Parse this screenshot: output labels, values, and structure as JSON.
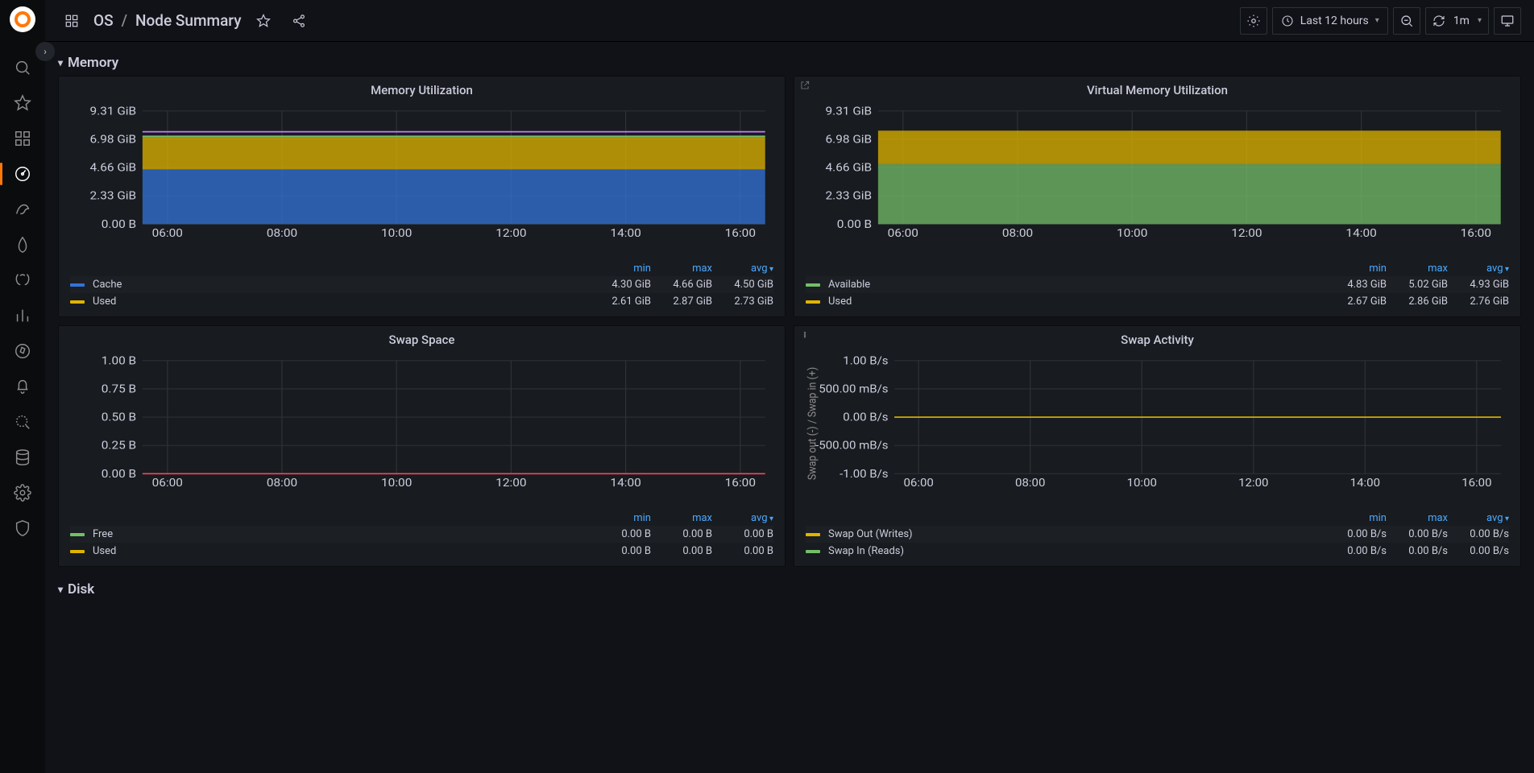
{
  "breadcrumb": {
    "folder": "OS",
    "page": "Node Summary"
  },
  "toolbar": {
    "time_range": "Last 12 hours",
    "refresh_interval": "1m"
  },
  "sections": {
    "memory": "Memory",
    "disk": "Disk"
  },
  "legend_cols": {
    "min": "min",
    "max": "max",
    "avg": "avg"
  },
  "chart_data": [
    {
      "id": "mem_util",
      "type": "area",
      "title": "Memory Utilization",
      "ylabel": "",
      "y_ticks": [
        "0.00 B",
        "2.33 GiB",
        "4.66 GiB",
        "6.98 GiB",
        "9.31 GiB"
      ],
      "ylim_gib": [
        0,
        9.31
      ],
      "x_ticks": [
        "06:00",
        "08:00",
        "10:00",
        "12:00",
        "14:00",
        "16:00"
      ],
      "series": [
        {
          "name": "Cache",
          "color": "#3274d9",
          "band": [
            0,
            4.5
          ],
          "stats": {
            "min": "4.30 GiB",
            "max": "4.66 GiB",
            "avg": "4.50 GiB"
          }
        },
        {
          "name": "Used",
          "color": "#e0b400",
          "band": [
            4.5,
            7.23
          ],
          "stats": {
            "min": "2.61 GiB",
            "max": "2.87 GiB",
            "avg": "2.73 GiB"
          }
        }
      ],
      "overlay_line": {
        "color": "#c77dff",
        "y_gib": 7.6
      },
      "top_line": {
        "color": "#73bf69",
        "y_gib": 7.23
      }
    },
    {
      "id": "vmem_util",
      "type": "area",
      "title": "Virtual Memory Utilization",
      "ylabel": "",
      "y_ticks": [
        "0.00 B",
        "2.33 GiB",
        "4.66 GiB",
        "6.98 GiB",
        "9.31 GiB"
      ],
      "ylim_gib": [
        0,
        9.31
      ],
      "x_ticks": [
        "06:00",
        "08:00",
        "10:00",
        "12:00",
        "14:00",
        "16:00"
      ],
      "corner_icon": "popout",
      "series": [
        {
          "name": "Available",
          "color": "#73bf69",
          "band": [
            0,
            4.93
          ],
          "stats": {
            "min": "4.83 GiB",
            "max": "5.02 GiB",
            "avg": "4.93 GiB"
          }
        },
        {
          "name": "Used",
          "color": "#e0b400",
          "band": [
            4.93,
            7.69
          ],
          "stats": {
            "min": "2.67 GiB",
            "max": "2.86 GiB",
            "avg": "2.76 GiB"
          }
        }
      ]
    },
    {
      "id": "swap_space",
      "type": "line",
      "title": "Swap Space",
      "ylabel": "",
      "y_ticks": [
        "0.00 B",
        "0.25 B",
        "0.50 B",
        "0.75 B",
        "1.00 B"
      ],
      "ylim": [
        0,
        1
      ],
      "x_ticks": [
        "06:00",
        "08:00",
        "10:00",
        "12:00",
        "14:00",
        "16:00"
      ],
      "series": [
        {
          "name": "Free",
          "color": "#73bf69",
          "flat": 0,
          "stats": {
            "min": "0.00 B",
            "max": "0.00 B",
            "avg": "0.00 B"
          }
        },
        {
          "name": "Used",
          "color": "#e0b400",
          "flat": 0,
          "stats": {
            "min": "0.00 B",
            "max": "0.00 B",
            "avg": "0.00 B"
          }
        }
      ],
      "zero_line_color": "#f2495c"
    },
    {
      "id": "swap_activity",
      "type": "line",
      "title": "Swap Activity",
      "ylabel": "Swap out (-) / Swap in (+)",
      "y_ticks": [
        "-1.00 B/s",
        "-500.00 mB/s",
        "0.00 B/s",
        "500.00 mB/s",
        "1.00 B/s"
      ],
      "ylim": [
        -1,
        1
      ],
      "x_ticks": [
        "06:00",
        "08:00",
        "10:00",
        "12:00",
        "14:00",
        "16:00"
      ],
      "corner_icon": "info",
      "series": [
        {
          "name": "Swap Out (Writes)",
          "color": "#e0b400",
          "flat": 0,
          "stats": {
            "min": "0.00 B/s",
            "max": "0.00 B/s",
            "avg": "0.00 B/s"
          }
        },
        {
          "name": "Swap In (Reads)",
          "color": "#73bf69",
          "flat": 0,
          "stats": {
            "min": "0.00 B/s",
            "max": "0.00 B/s",
            "avg": "0.00 B/s"
          }
        }
      ],
      "zero_line_color": "#e0b400"
    }
  ]
}
